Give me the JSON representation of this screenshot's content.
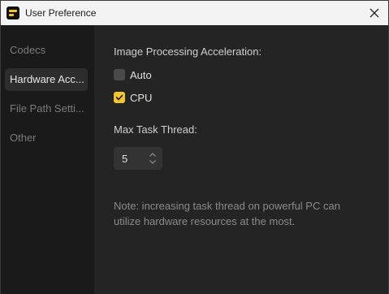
{
  "window": {
    "title": "User Preference",
    "icons": {
      "app": "app-logo-icon",
      "close": "close-icon"
    }
  },
  "sidebar": {
    "items": [
      {
        "label": "Codecs",
        "active": false
      },
      {
        "label": "Hardware Acc...",
        "active": true
      },
      {
        "label": "File Path Setti...",
        "active": false
      },
      {
        "label": "Other",
        "active": false
      }
    ]
  },
  "main": {
    "acceleration_label": "Image Processing Acceleration:",
    "options": [
      {
        "label": "Auto",
        "checked": false
      },
      {
        "label": "CPU",
        "checked": true
      }
    ],
    "max_task_label": "Max Task Thread:",
    "max_task_value": "5",
    "note": "Note: increasing task thread on powerful PC can utilize hardware resources at the most."
  },
  "colors": {
    "accent": "#f4c531",
    "background": "#242424",
    "sidebar": "#1a1a1a"
  }
}
